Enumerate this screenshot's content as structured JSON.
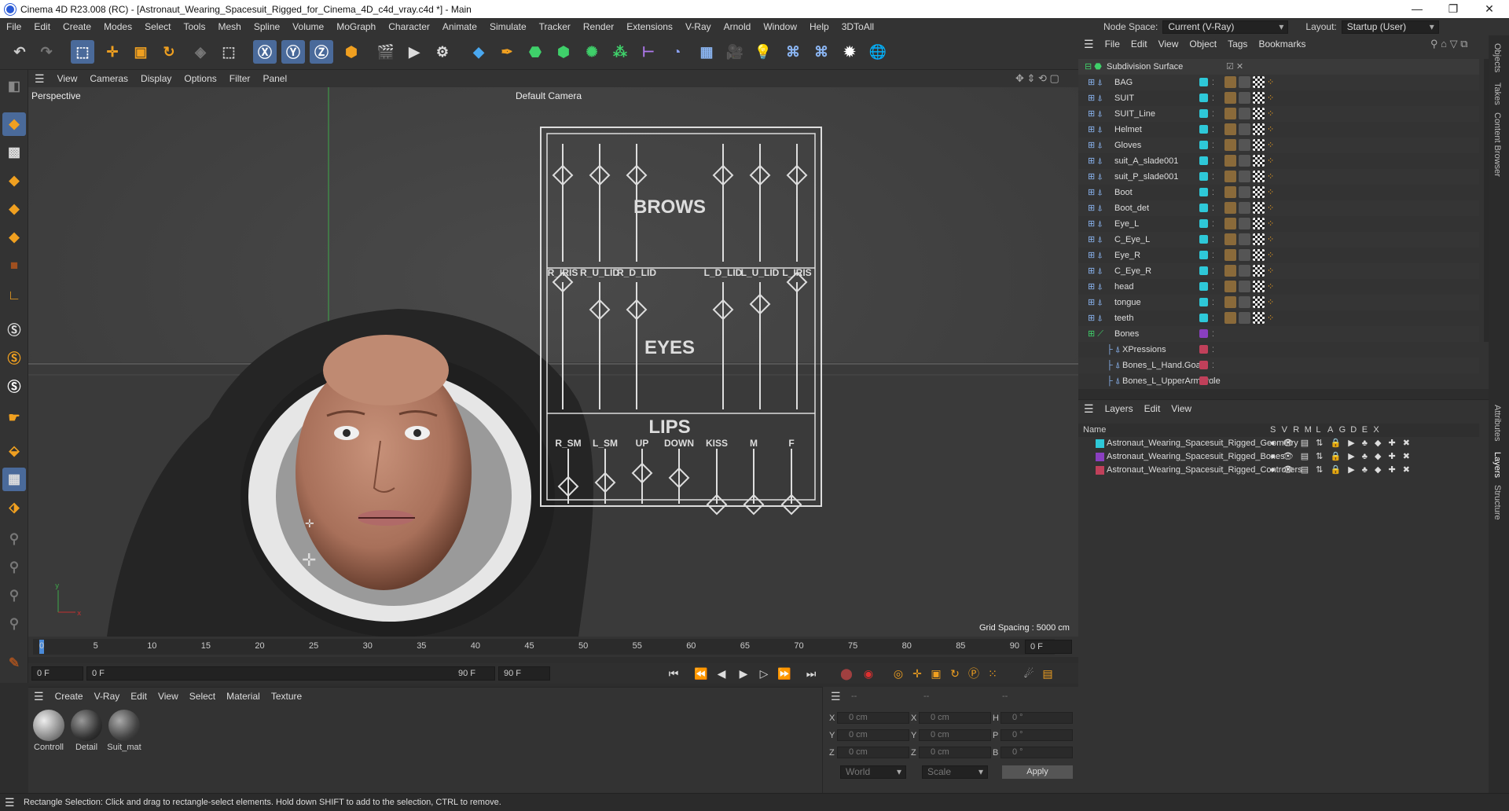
{
  "window": {
    "title": "Cinema 4D R23.008 (RC) - [Astronaut_Wearing_Spacesuit_Rigged_for_Cinema_4D_c4d_vray.c4d *] - Main",
    "min": "—",
    "max": "❐",
    "close": "✕"
  },
  "menubar": {
    "items": [
      "File",
      "Edit",
      "Create",
      "Modes",
      "Select",
      "Tools",
      "Mesh",
      "Spline",
      "Volume",
      "MoGraph",
      "Character",
      "Animate",
      "Simulate",
      "Tracker",
      "Render",
      "Extensions",
      "V-Ray",
      "Arnold",
      "Window",
      "Help",
      "3DToAll"
    ],
    "node_space_label": "Node Space:",
    "node_space_value": "Current (V-Ray)",
    "layout_label": "Layout:",
    "layout_value": "Startup (User)"
  },
  "viewport": {
    "menu": [
      "View",
      "Cameras",
      "Display",
      "Options",
      "Filter",
      "Panel"
    ],
    "name": "Perspective",
    "camera": "Default Camera",
    "grid": "Grid Spacing : 5000 cm",
    "board": {
      "brows": "BROWS",
      "eyes": "EYES",
      "lips": "LIPS",
      "eye_labels": [
        "R_IRIS",
        "R_U_LID",
        "R_D_LID",
        "L_D_LID",
        "L_U_LID",
        "L_IRIS"
      ],
      "lip_labels": [
        "R_SM",
        "L_SM",
        "UP",
        "DOWN",
        "KISS",
        "M",
        "F"
      ]
    }
  },
  "timeline": {
    "ticks": [
      "0",
      "5",
      "10",
      "15",
      "20",
      "25",
      "30",
      "35",
      "40",
      "45",
      "50",
      "55",
      "60",
      "65",
      "70",
      "75",
      "80",
      "85",
      "90"
    ],
    "current": "0 F"
  },
  "playbar": {
    "start": "0 F",
    "cur": "0 F",
    "end": "90 F",
    "end2": "90 F"
  },
  "materials": {
    "menu": [
      "Create",
      "V-Ray",
      "Edit",
      "View",
      "Select",
      "Material",
      "Texture"
    ],
    "items": [
      "Controll",
      "Detail",
      "Suit_mat"
    ]
  },
  "coords": {
    "header": [
      "--",
      "--",
      "--"
    ],
    "x": "X",
    "y": "Y",
    "z": "Z",
    "h": "H",
    "p": "P",
    "b": "B",
    "zero_cm": "0 cm",
    "zero_deg": "0 °",
    "world": "World",
    "scale": "Scale",
    "apply": "Apply"
  },
  "status": "Rectangle Selection: Click and drag to rectangle-select elements. Hold down SHIFT to add to the selection, CTRL to remove.",
  "objects": {
    "menu": [
      "File",
      "Edit",
      "View",
      "Object",
      "Tags",
      "Bookmarks"
    ],
    "root": "Subdivision Surface",
    "rows": [
      "BAG",
      "SUIT",
      "SUIT_Line",
      "Helmet",
      "Gloves",
      "suit_A_slade001",
      "suit_P_slade001",
      "Boot",
      "Boot_det",
      "Eye_L",
      "C_Eye_L",
      "Eye_R",
      "C_Eye_R",
      "head",
      "tongue",
      "teeth",
      "Bones",
      "XPressions",
      "Bones_L_Hand.Goal",
      "Bones_L_UpperArm.Pole"
    ]
  },
  "layers": {
    "menu": [
      "Layers",
      "Edit",
      "View"
    ],
    "name_header": "Name",
    "cols": [
      "S",
      "V",
      "R",
      "M",
      "L",
      "A",
      "G",
      "D",
      "E",
      "X"
    ],
    "rows": [
      {
        "name": "Astronaut_Wearing_Spacesuit_Rigged_Geometry",
        "color": "#2ec8d8"
      },
      {
        "name": "Astronaut_Wearing_Spacesuit_Rigged_Bones",
        "color": "#8a3fc0"
      },
      {
        "name": "Astronaut_Wearing_Spacesuit_Rigged_Controllers",
        "color": "#c0405a"
      }
    ]
  },
  "sidetabs": [
    "Objects",
    "Takes",
    "Content Browser",
    "Attributes",
    "Layers",
    "Structure"
  ]
}
